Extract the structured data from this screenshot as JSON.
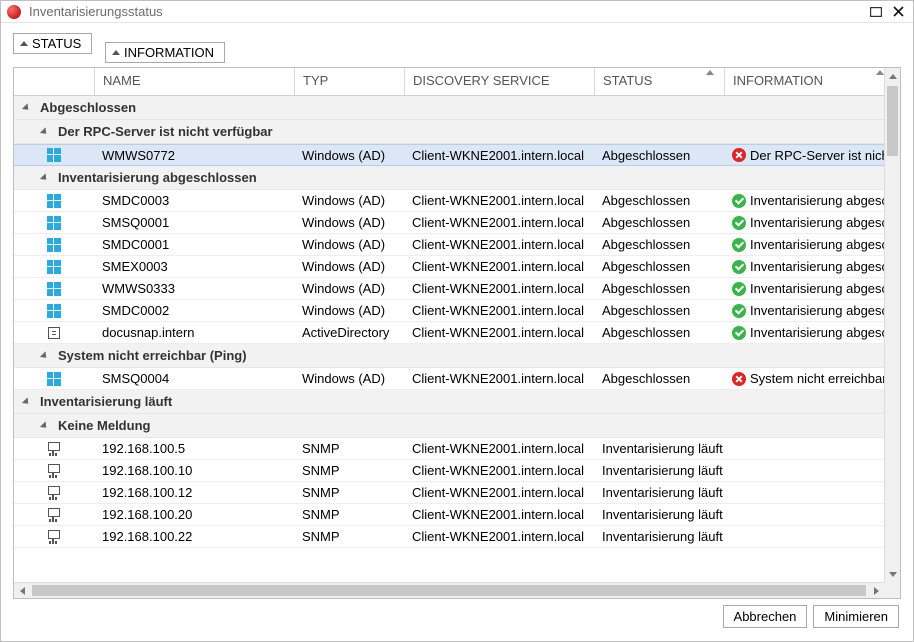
{
  "window": {
    "title": "Inventarisierungsstatus"
  },
  "tabs": {
    "status": "STATUS",
    "information": "INFORMATION"
  },
  "columns": {
    "name": "NAME",
    "typ": "TYP",
    "discovery": "DISCOVERY SERVICE",
    "status": "STATUS",
    "information": "INFORMATION"
  },
  "groups": [
    {
      "label": "Abgeschlossen",
      "subgroups": [
        {
          "label": "Der RPC-Server ist nicht verfügbar",
          "rows": [
            {
              "icon": "win",
              "name": "WMWS0772",
              "typ": "Windows (AD)",
              "discovery": "Client-WKNE2001.intern.local",
              "status": "Abgeschlossen",
              "infoIcon": "err",
              "info": "Der RPC-Server ist nicht",
              "selected": true
            }
          ]
        },
        {
          "label": "Inventarisierung abgeschlossen",
          "rows": [
            {
              "icon": "win",
              "name": "SMDC0003",
              "typ": "Windows (AD)",
              "discovery": "Client-WKNE2001.intern.local",
              "status": "Abgeschlossen",
              "infoIcon": "ok",
              "info": "Inventarisierung abgescl"
            },
            {
              "icon": "win",
              "name": "SMSQ0001",
              "typ": "Windows (AD)",
              "discovery": "Client-WKNE2001.intern.local",
              "status": "Abgeschlossen",
              "infoIcon": "ok",
              "info": "Inventarisierung abgescl"
            },
            {
              "icon": "win",
              "name": "SMDC0001",
              "typ": "Windows (AD)",
              "discovery": "Client-WKNE2001.intern.local",
              "status": "Abgeschlossen",
              "infoIcon": "ok",
              "info": "Inventarisierung abgescl"
            },
            {
              "icon": "win",
              "name": "SMEX0003",
              "typ": "Windows (AD)",
              "discovery": "Client-WKNE2001.intern.local",
              "status": "Abgeschlossen",
              "infoIcon": "ok",
              "info": "Inventarisierung abgescl"
            },
            {
              "icon": "win",
              "name": "WMWS0333",
              "typ": "Windows (AD)",
              "discovery": "Client-WKNE2001.intern.local",
              "status": "Abgeschlossen",
              "infoIcon": "ok",
              "info": "Inventarisierung abgescl"
            },
            {
              "icon": "win",
              "name": "SMDC0002",
              "typ": "Windows (AD)",
              "discovery": "Client-WKNE2001.intern.local",
              "status": "Abgeschlossen",
              "infoIcon": "ok",
              "info": "Inventarisierung abgescl"
            },
            {
              "icon": "ad",
              "name": "docusnap.intern",
              "typ": "ActiveDirectory",
              "discovery": "Client-WKNE2001.intern.local",
              "status": "Abgeschlossen",
              "infoIcon": "ok",
              "info": "Inventarisierung abgescl"
            }
          ]
        },
        {
          "label": "System nicht erreichbar (Ping)",
          "rows": [
            {
              "icon": "win",
              "name": "SMSQ0004",
              "typ": "Windows (AD)",
              "discovery": "Client-WKNE2001.intern.local",
              "status": "Abgeschlossen",
              "infoIcon": "err",
              "info": "System nicht erreichbar"
            }
          ]
        }
      ]
    },
    {
      "label": "Inventarisierung läuft",
      "subgroups": [
        {
          "label": "Keine Meldung",
          "rows": [
            {
              "icon": "snmp",
              "name": "192.168.100.5",
              "typ": "SNMP",
              "discovery": "Client-WKNE2001.intern.local",
              "status": "Inventarisierung läuft",
              "infoIcon": "",
              "info": ""
            },
            {
              "icon": "snmp",
              "name": "192.168.100.10",
              "typ": "SNMP",
              "discovery": "Client-WKNE2001.intern.local",
              "status": "Inventarisierung läuft",
              "infoIcon": "",
              "info": ""
            },
            {
              "icon": "snmp",
              "name": "192.168.100.12",
              "typ": "SNMP",
              "discovery": "Client-WKNE2001.intern.local",
              "status": "Inventarisierung läuft",
              "infoIcon": "",
              "info": ""
            },
            {
              "icon": "snmp",
              "name": "192.168.100.20",
              "typ": "SNMP",
              "discovery": "Client-WKNE2001.intern.local",
              "status": "Inventarisierung läuft",
              "infoIcon": "",
              "info": ""
            },
            {
              "icon": "snmp",
              "name": "192.168.100.22",
              "typ": "SNMP",
              "discovery": "Client-WKNE2001.intern.local",
              "status": "Inventarisierung läuft",
              "infoIcon": "",
              "info": ""
            }
          ]
        }
      ]
    }
  ],
  "buttons": {
    "cancel": "Abbrechen",
    "minimize": "Minimieren"
  }
}
